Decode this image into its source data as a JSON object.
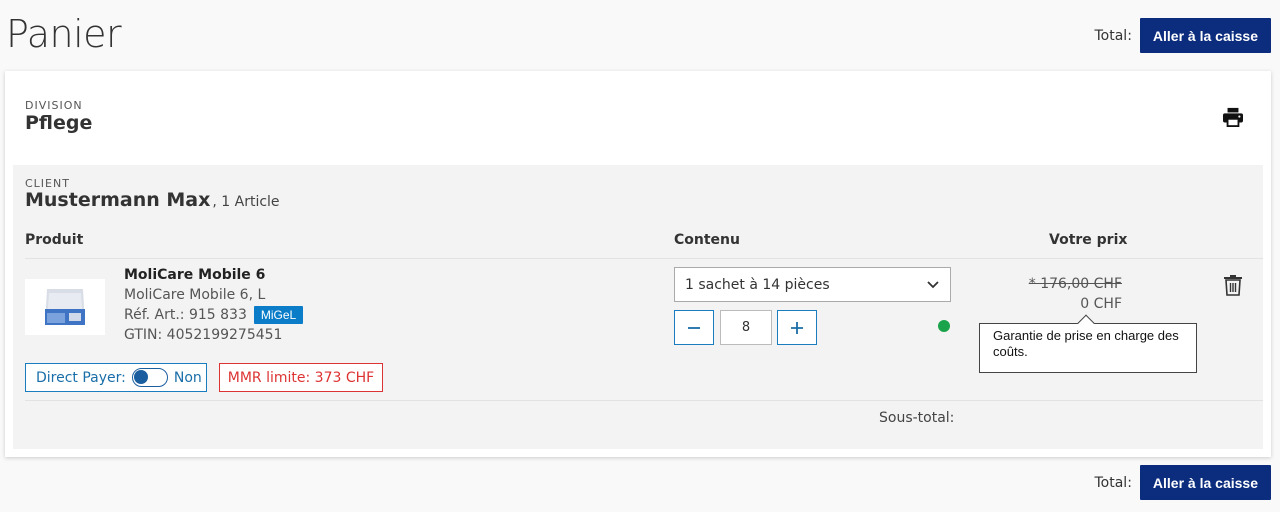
{
  "page": {
    "title": "Panier"
  },
  "summary": {
    "total_label": "Total:",
    "checkout_label": "Aller à la caisse"
  },
  "division": {
    "label": "DIVISION",
    "name": "Pflege"
  },
  "client": {
    "label": "CLIENT",
    "name": "Mustermann Max",
    "count": ", 1 Article"
  },
  "table": {
    "headers": {
      "product": "Produit",
      "content": "Contenu",
      "price": "Votre prix"
    },
    "item": {
      "title": "MoliCare Mobile 6",
      "subtitle": "MoliCare Mobile 6, L",
      "ref": "Réf. Art.: 915 833",
      "badge": "MiGeL",
      "gtin": "GTIN: 4052199275451",
      "direct_payer_label": "Direct Payer:",
      "direct_payer_value": "Non",
      "mmr_limit": "MMR limite: 373 CHF",
      "package": "1 sachet à 14 pièces",
      "quantity": "8",
      "old_price": "* 176,00 CHF",
      "new_price": "0 CHF",
      "tooltip": "Garantie de prise en charge des coûts."
    },
    "subtotal_label": "Sous-total:"
  },
  "colors": {
    "accent": "#0c2d7e",
    "link": "#1a7dc0",
    "badge": "#0a7cc8",
    "error": "#dd3333",
    "status_ok": "#1aa34a"
  },
  "icons": [
    "print-icon",
    "trash-icon",
    "chevron-down-icon",
    "minus-icon",
    "plus-icon"
  ]
}
